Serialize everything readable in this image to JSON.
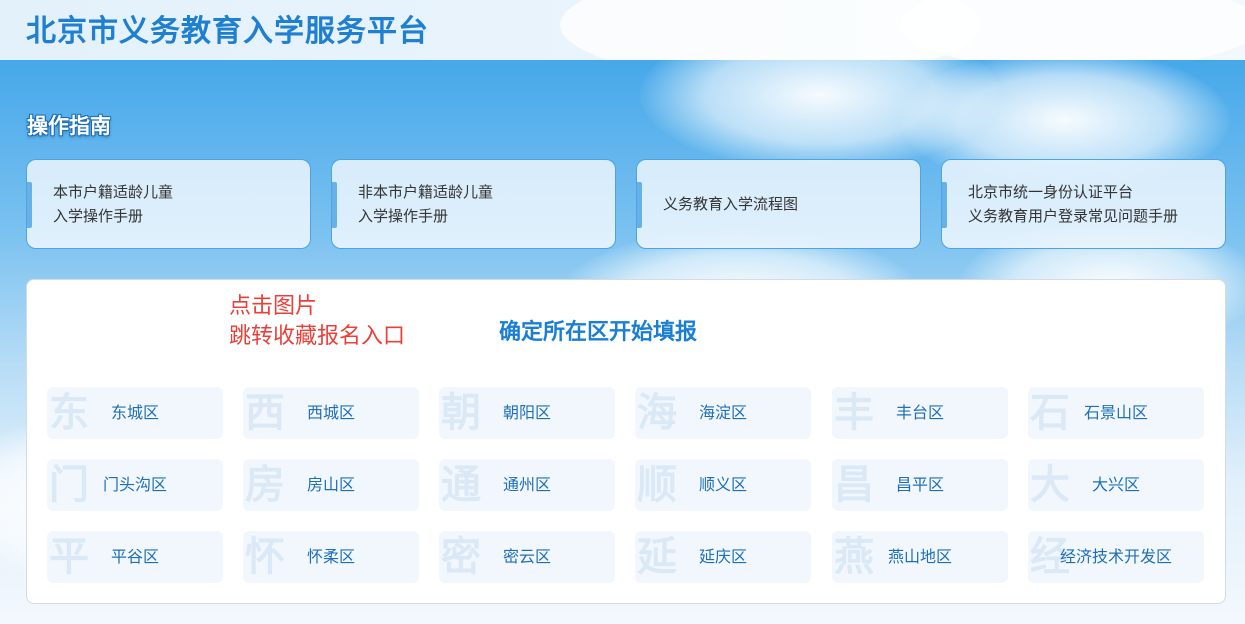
{
  "header": {
    "title": "北京市义务教育入学服务平台"
  },
  "guide": {
    "title": "操作指南",
    "cards": [
      {
        "line1": "本市户籍适龄儿童",
        "line2": "入学操作手册"
      },
      {
        "line1": "非本市户籍适龄儿童",
        "line2": "入学操作手册"
      },
      {
        "line1": "义务教育入学流程图",
        "line2": ""
      },
      {
        "line1": "北京市统一身份认证平台",
        "line2": "义务教育用户登录常见问题手册"
      }
    ]
  },
  "panel": {
    "annotation_line1": "点击图片",
    "annotation_line2": "跳转收藏报名入口",
    "heading": "确定所在区开始填报",
    "districts": [
      {
        "name": "东城区",
        "watermark": "东"
      },
      {
        "name": "西城区",
        "watermark": "西"
      },
      {
        "name": "朝阳区",
        "watermark": "朝"
      },
      {
        "name": "海淀区",
        "watermark": "海"
      },
      {
        "name": "丰台区",
        "watermark": "丰"
      },
      {
        "name": "石景山区",
        "watermark": "石"
      },
      {
        "name": "门头沟区",
        "watermark": "门"
      },
      {
        "name": "房山区",
        "watermark": "房"
      },
      {
        "name": "通州区",
        "watermark": "通"
      },
      {
        "name": "顺义区",
        "watermark": "顺"
      },
      {
        "name": "昌平区",
        "watermark": "昌"
      },
      {
        "name": "大兴区",
        "watermark": "大"
      },
      {
        "name": "平谷区",
        "watermark": "平"
      },
      {
        "name": "怀柔区",
        "watermark": "怀"
      },
      {
        "name": "密云区",
        "watermark": "密"
      },
      {
        "name": "延庆区",
        "watermark": "延"
      },
      {
        "name": "燕山地区",
        "watermark": "燕"
      },
      {
        "name": "经济技术开发区",
        "watermark": "经"
      }
    ]
  },
  "colors": {
    "title_blue": "#1f7fd1",
    "heading_blue": "#1a7fd4",
    "district_text": "#1f6fb8",
    "annotation_red": "#e9413a",
    "card_border": "#4fa3e3"
  }
}
